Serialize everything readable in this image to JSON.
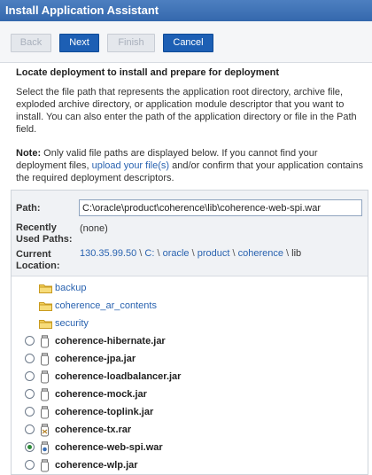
{
  "window": {
    "title": "Install Application Assistant"
  },
  "toolbar": {
    "back_label": "Back",
    "next_label": "Next",
    "finish_label": "Finish",
    "cancel_label": "Cancel"
  },
  "content": {
    "heading": "Locate deployment to install and prepare for deployment",
    "description": "Select the file path that represents the application root directory, archive file, exploded archive directory, or application module descriptor that you want to install. You can also enter the path of the application directory or file in the Path field.",
    "note_label": "Note:",
    "note_text_1": " Only valid file paths are displayed below. If you cannot find your deployment files, ",
    "note_link": "upload your file(s)",
    "note_text_2": " and/or confirm that your application contains the required deployment descriptors."
  },
  "path_panel": {
    "path_label": "Path:",
    "path_value": "C:\\oracle\\product\\coherence\\lib\\coherence-web-spi.war",
    "recent_label_1": "Recently",
    "recent_label_2": "Used Paths:",
    "recent_value": "(none)",
    "location_label_1": "Current",
    "location_label_2": "Location:",
    "crumbs": [
      "130.35.99.50",
      "C:",
      "oracle",
      "product",
      "coherence",
      "lib"
    ],
    "crumb_sep": "\\"
  },
  "colors": {
    "title_bar": "#3e72b8",
    "primary_button": "#1d5fb4",
    "link": "#2a63b0"
  },
  "tree": {
    "folders": [
      "backup",
      "coherence_ar_contents",
      "security"
    ],
    "files": [
      {
        "name": "coherence-hibernate.jar",
        "icon": "jar-icon",
        "selected": false
      },
      {
        "name": "coherence-jpa.jar",
        "icon": "jar-icon",
        "selected": false
      },
      {
        "name": "coherence-loadbalancer.jar",
        "icon": "jar-icon",
        "selected": false
      },
      {
        "name": "coherence-mock.jar",
        "icon": "jar-icon",
        "selected": false
      },
      {
        "name": "coherence-toplink.jar",
        "icon": "jar-icon",
        "selected": false
      },
      {
        "name": "coherence-tx.rar",
        "icon": "rar-icon",
        "selected": false
      },
      {
        "name": "coherence-web-spi.war",
        "icon": "war-icon",
        "selected": true
      },
      {
        "name": "coherence-wlp.jar",
        "icon": "jar-icon",
        "selected": false
      }
    ]
  }
}
